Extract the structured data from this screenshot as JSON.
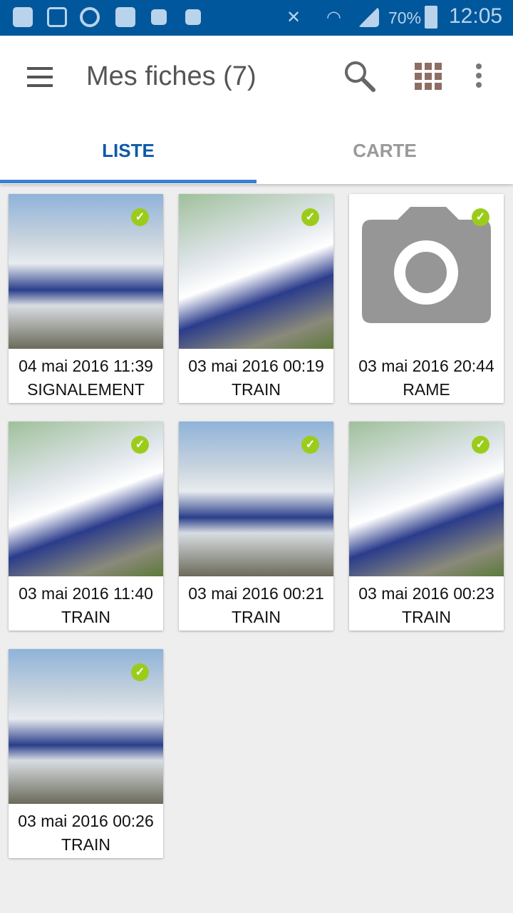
{
  "status_bar": {
    "battery": "70%",
    "time": "12:05",
    "icons": [
      "runner-icon",
      "gallery-icon",
      "power-icon",
      "email-icon",
      "outlook-icon",
      "outlook-icon",
      "mute-icon",
      "wifi-icon",
      "signal-icon",
      "battery-icon"
    ]
  },
  "header": {
    "title": "Mes fiches (7)",
    "icons": [
      "menu-icon",
      "search-icon",
      "grid-icon",
      "more-icon"
    ]
  },
  "tabs": [
    {
      "label": "LISTE",
      "active": true
    },
    {
      "label": "CARTE",
      "active": false
    }
  ],
  "colors": {
    "status_bar": "#01579b",
    "tab_active": "#0d5aa7",
    "check": "#9ccc1b"
  },
  "cards": [
    {
      "date": "04 mai 2016 11:39",
      "type": "SIGNALEMENT",
      "image": "photo"
    },
    {
      "date": "03 mai 2016 00:19",
      "type": "TRAIN",
      "image": "photo"
    },
    {
      "date": "03 mai 2016 20:44",
      "type": "RAME",
      "image": "camera-placeholder"
    },
    {
      "date": "03 mai 2016 11:40",
      "type": "TRAIN",
      "image": "photo"
    },
    {
      "date": "03 mai 2016 00:21",
      "type": "TRAIN",
      "image": "photo"
    },
    {
      "date": "03 mai 2016 00:23",
      "type": "TRAIN",
      "image": "photo"
    },
    {
      "date": "03 mai 2016 00:26",
      "type": "TRAIN",
      "image": "photo"
    }
  ]
}
